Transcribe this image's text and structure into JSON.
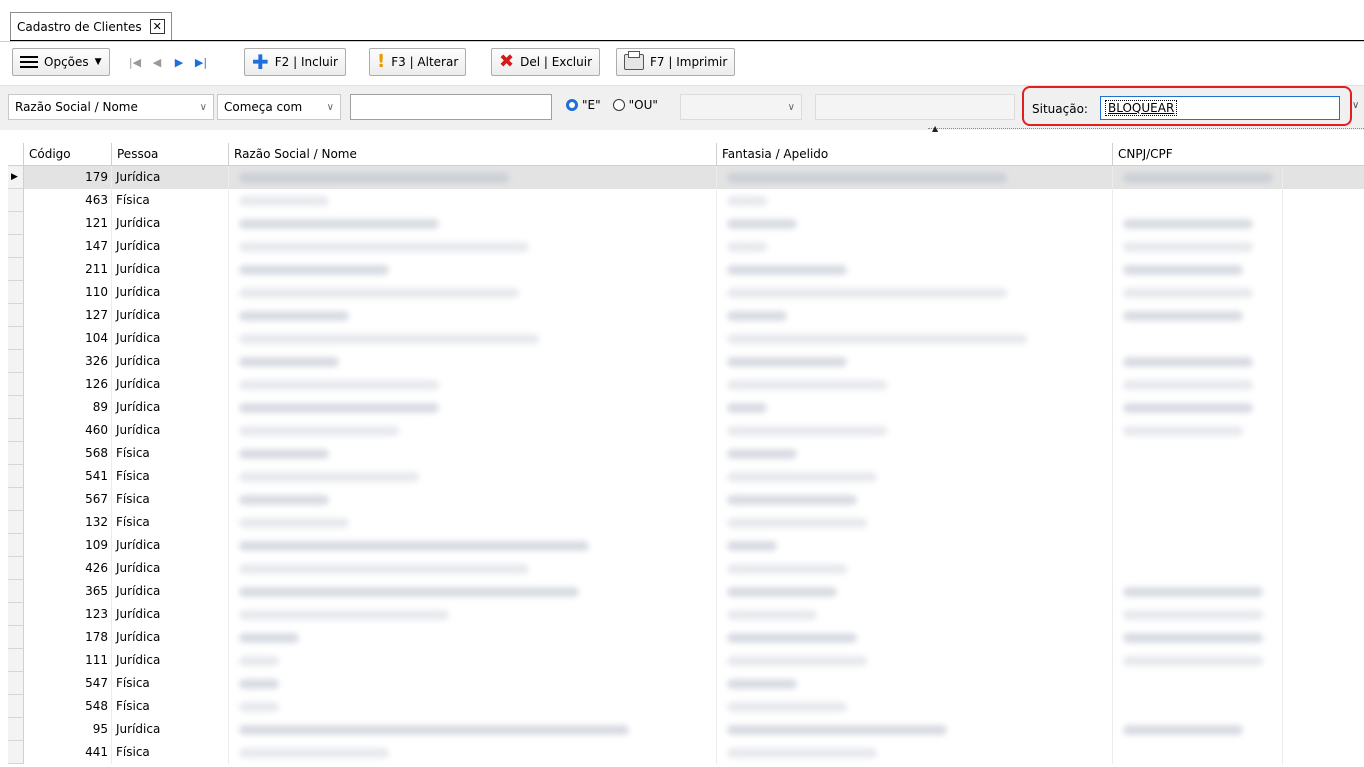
{
  "tab": {
    "label": "Cadastro de Clientes",
    "close_glyph": "✕"
  },
  "toolbar": {
    "options_label": "Opções",
    "first_glyph": "|◀",
    "prev_glyph": "◀",
    "next_glyph": "▶",
    "last_glyph": "▶|",
    "insert_label": "F2 | Incluir",
    "alter_label": "F3 | Alterar",
    "delete_label": "Del | Excluir",
    "print_label": "F7 | Imprimir"
  },
  "filter": {
    "field": "Razão Social / Nome",
    "operator": "Começa com",
    "search_value": "",
    "radio_e": "\"E\"",
    "radio_ou": "\"OU\"",
    "radio_selected": "E",
    "situacao_label": "Situação:",
    "situacao_value": "BLOQUEAR"
  },
  "grid": {
    "columns": [
      "Código",
      "Pessoa",
      "Razão Social / Nome",
      "Fantasia / Apelido",
      "CNPJ/CPF"
    ],
    "rows": [
      {
        "codigo": "179",
        "pessoa": "Jurídica"
      },
      {
        "codigo": "463",
        "pessoa": "Física"
      },
      {
        "codigo": "121",
        "pessoa": "Jurídica"
      },
      {
        "codigo": "147",
        "pessoa": "Jurídica"
      },
      {
        "codigo": "211",
        "pessoa": "Jurídica"
      },
      {
        "codigo": "110",
        "pessoa": "Jurídica"
      },
      {
        "codigo": "127",
        "pessoa": "Jurídica"
      },
      {
        "codigo": "104",
        "pessoa": "Jurídica"
      },
      {
        "codigo": "326",
        "pessoa": "Jurídica"
      },
      {
        "codigo": "126",
        "pessoa": "Jurídica"
      },
      {
        "codigo": "89",
        "pessoa": "Jurídica"
      },
      {
        "codigo": "460",
        "pessoa": "Jurídica"
      },
      {
        "codigo": "568",
        "pessoa": "Física"
      },
      {
        "codigo": "541",
        "pessoa": "Física"
      },
      {
        "codigo": "567",
        "pessoa": "Física"
      },
      {
        "codigo": "132",
        "pessoa": "Física"
      },
      {
        "codigo": "109",
        "pessoa": "Jurídica"
      },
      {
        "codigo": "426",
        "pessoa": "Jurídica"
      },
      {
        "codigo": "365",
        "pessoa": "Jurídica"
      },
      {
        "codigo": "123",
        "pessoa": "Jurídica"
      },
      {
        "codigo": "178",
        "pessoa": "Jurídica"
      },
      {
        "codigo": "111",
        "pessoa": "Jurídica"
      },
      {
        "codigo": "547",
        "pessoa": "Física"
      },
      {
        "codigo": "548",
        "pessoa": "Física"
      },
      {
        "codigo": "95",
        "pessoa": "Jurídica"
      },
      {
        "codigo": "441",
        "pessoa": "Física"
      }
    ]
  }
}
